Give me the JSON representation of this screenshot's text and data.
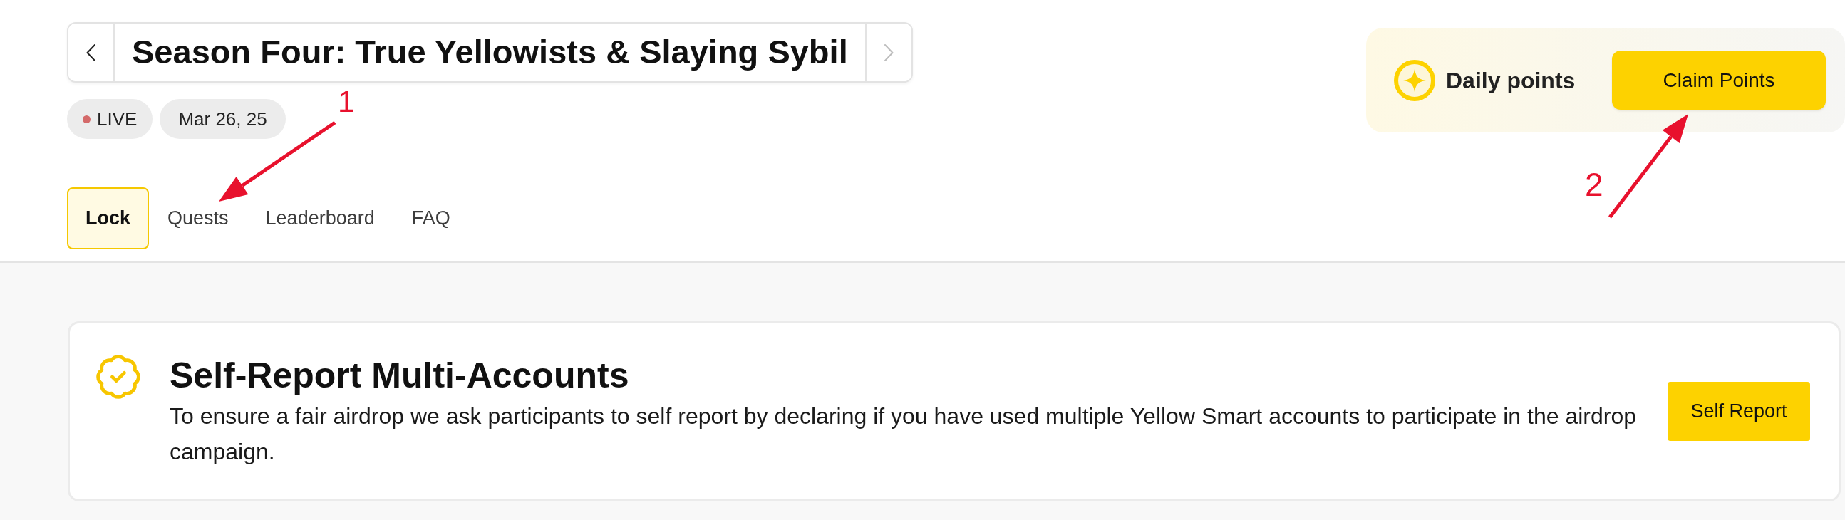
{
  "header": {
    "nav": [
      {
        "kind": "prev",
        "disabled": false
      },
      {
        "kind": "next",
        "disabled": true
      }
    ],
    "title": "Season Four: True Yellowists & Slaying Sybil",
    "status": "LIVE",
    "date": "Mar 26, 25"
  },
  "tabs": [
    {
      "label": "Lock",
      "selected": true
    },
    {
      "label": "Quests",
      "selected": false
    },
    {
      "label": "Leaderboard",
      "selected": false
    },
    {
      "label": "FAQ",
      "selected": false
    }
  ],
  "daily_points": {
    "label": "Daily points",
    "button": "Claim Points"
  },
  "card": {
    "title": "Self-Report Multi-Accounts",
    "description": "To ensure a fair airdrop we ask participants to self report by declaring if you have used multiple Yellow Smart accounts to participate in the airdrop campaign.",
    "button": "Self Report"
  },
  "annotations": [
    {
      "label": "1"
    },
    {
      "label": "2"
    }
  ]
}
